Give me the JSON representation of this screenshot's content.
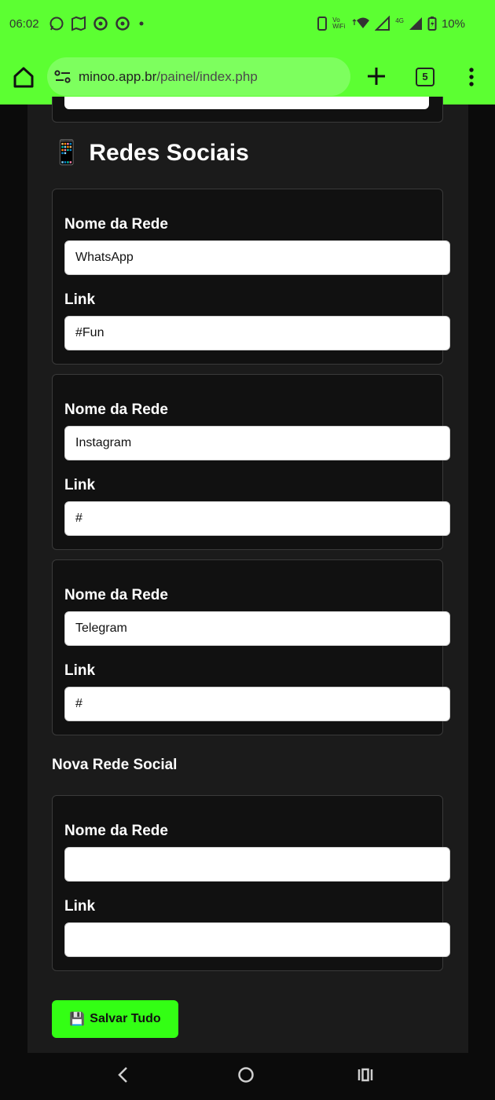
{
  "status_bar": {
    "time": "06:02",
    "network_volte": "Vo",
    "network_wifi": "WiFi",
    "network_4g": "4G",
    "battery": "10%"
  },
  "browser": {
    "url_host": "minoo.app.br",
    "url_path": "/painel/index.php",
    "tab_count": "5"
  },
  "section": {
    "icon": "📱",
    "title": "Redes Sociais"
  },
  "labels": {
    "name": "Nome da Rede",
    "link": "Link"
  },
  "social_networks": [
    {
      "name": "WhatsApp",
      "link": "#Fun"
    },
    {
      "name": "Instagram",
      "link": "#"
    },
    {
      "name": "Telegram",
      "link": "#"
    }
  ],
  "new_network": {
    "title": "Nova Rede Social",
    "name": "",
    "link": ""
  },
  "save_button": {
    "icon": "💾",
    "label": "Salvar Tudo"
  },
  "colors": {
    "accent": "#33ff14",
    "browser_bar": "#5cff32",
    "background": "#1b1b1b",
    "card": "#111111"
  }
}
